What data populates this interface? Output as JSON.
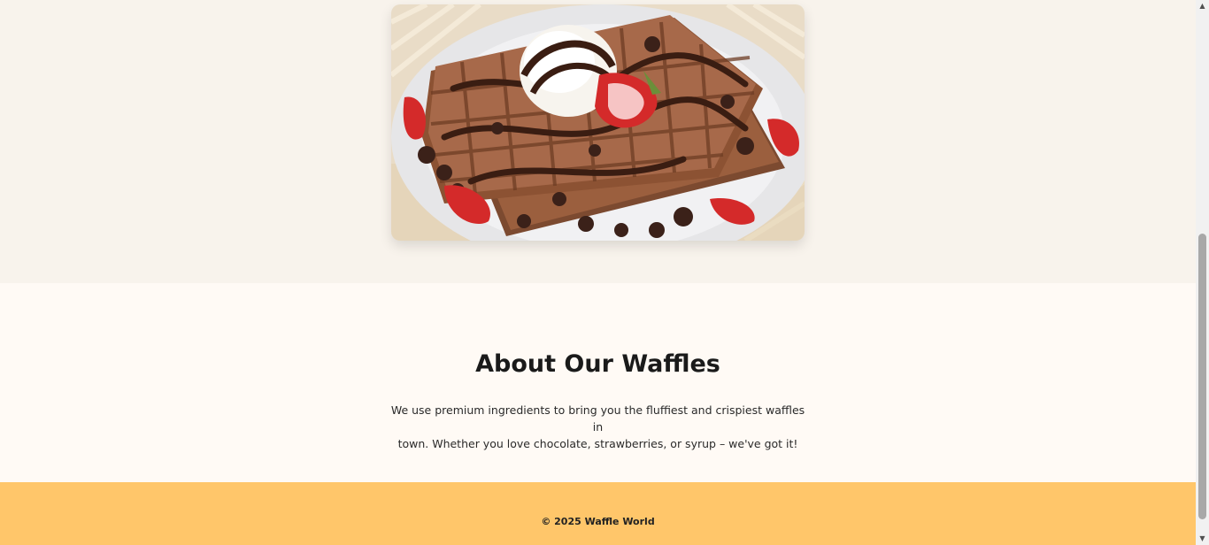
{
  "hero": {
    "image_alt": "Chocolate waffles with ice cream, chocolate syrup and strawberries"
  },
  "about": {
    "title": "About Our Waffles",
    "text_line1": "We use premium ingredients to bring you the fluffiest and crispiest waffles in",
    "text_line2": "town. Whether you love chocolate, strawberries, or syrup – we've got it!"
  },
  "footer": {
    "copyright": "© 2025 Waffle World"
  },
  "colors": {
    "hero_bg": "#f8f3ec",
    "about_bg": "#fffaf5",
    "footer_bg": "#ffc66a"
  },
  "scrollbar": {
    "up_icon": "triangle-up-icon",
    "down_icon": "triangle-down-icon"
  }
}
